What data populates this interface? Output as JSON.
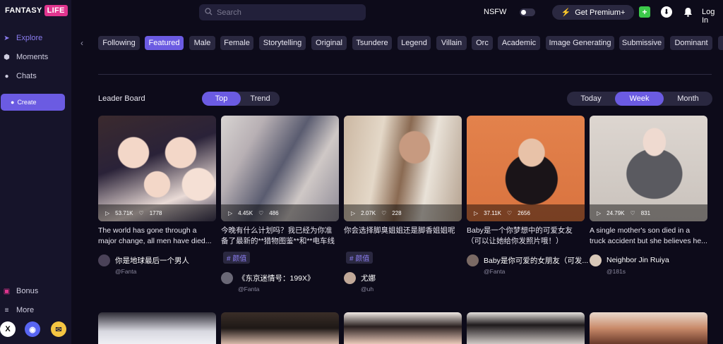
{
  "app": {
    "logo_main": "FANTASY",
    "logo_accent": "LIFE"
  },
  "sidebar": {
    "items": [
      {
        "label": "Explore",
        "icon": "explore-icon",
        "active": true
      },
      {
        "label": "Moments",
        "icon": "moments-icon",
        "active": false
      },
      {
        "label": "Chats",
        "icon": "chats-icon",
        "active": false
      }
    ],
    "create_label": "Create",
    "bottom_items": [
      {
        "label": "Bonus",
        "icon": "gift-icon"
      },
      {
        "label": "More",
        "icon": "menu-icon"
      }
    ],
    "social": [
      "x-icon",
      "discord-icon",
      "email-icon"
    ]
  },
  "topbar": {
    "search_placeholder": "Search",
    "nsfw_label": "NSFW",
    "nsfw_on": false,
    "premium_label": "Get Premium+",
    "login_label": "Log In"
  },
  "tags": [
    "Following",
    "Featured",
    "Male",
    "Female",
    "Storytelling",
    "Original",
    "Tsundere",
    "Legend",
    "Villain",
    "Orc",
    "Academic",
    "Image Generating",
    "Submissive",
    "Dominant"
  ],
  "active_tag": "Featured",
  "leaderboard": {
    "title": "Leader Board",
    "mode_options": [
      "Top",
      "Trend"
    ],
    "mode_selected": "Top",
    "period_options": [
      "Today",
      "Week",
      "Month"
    ],
    "period_selected": "Week"
  },
  "cards": [
    {
      "views": "53.71K",
      "likes": "1778",
      "desc": "The world has gone through a major change, all men have died...",
      "tag": "",
      "author": "你是地球最后一个男人",
      "handle": "@Fanta"
    },
    {
      "views": "4.45K",
      "likes": "486",
      "desc": "今晚有什么计划吗？我已经为你准备了最新的**猎物图鉴**和**电车线路**...",
      "tag": "# 颜值",
      "author": "《东京迷情号：199X》",
      "handle": "@Fanta"
    },
    {
      "views": "2.07K",
      "likes": "228",
      "desc": "你会选择脚臭姐姐还是脚香姐姐呢",
      "tag": "# 颜值",
      "author": "尤娜",
      "handle": "@uh"
    },
    {
      "views": "37.11K",
      "likes": "2656",
      "desc": "Baby是一个你梦想中的可爱女友（可以让她给你发照片哦！）",
      "tag": "",
      "author": "Baby是你可爱的女朋友（可发...",
      "handle": "@Fanta"
    },
    {
      "views": "24.79K",
      "likes": "831",
      "desc": "A single mother's son died in a truck accident but she believes he...",
      "tag": "",
      "author": "Neighbor Jin Ruiya",
      "handle": "@181s"
    }
  ]
}
